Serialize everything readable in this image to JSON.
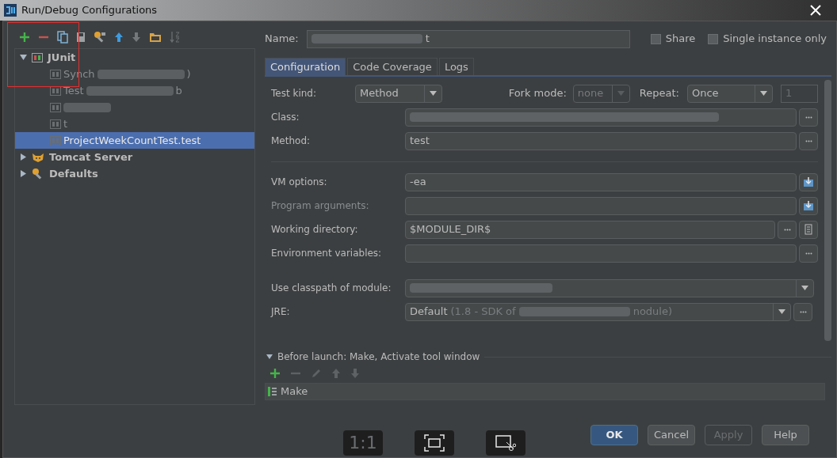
{
  "window": {
    "title": "Run/Debug Configurations"
  },
  "toolbar": [
    {
      "kind": "add"
    },
    {
      "kind": "remove"
    },
    {
      "kind": "copy"
    },
    {
      "kind": "save"
    },
    {
      "kind": "edit-defaults"
    },
    {
      "kind": "up"
    },
    {
      "kind": "down"
    },
    {
      "kind": "folder"
    },
    {
      "kind": "sort"
    }
  ],
  "tree": [
    {
      "label": "JUnit",
      "kind": "junit",
      "expanded": true,
      "children": [
        {
          "label": "Synch",
          "tail": ")",
          "selected": false
        },
        {
          "label": "Test",
          "tail": "b",
          "selected": false
        },
        {
          "kind": "redacted",
          "selected": false
        },
        {
          "label": "t",
          "selected": false
        },
        {
          "label": "ProjectWeekCountTest.test",
          "selected": true
        }
      ]
    },
    {
      "label": "Tomcat Server",
      "kind": "tomcat",
      "expanded": false
    },
    {
      "label": "Defaults",
      "kind": "defaults",
      "expanded": false
    }
  ],
  "name": {
    "label": "Name:",
    "value": "t"
  },
  "options": [
    {
      "label": "Share",
      "checked": false
    },
    {
      "label": "Single instance only",
      "checked": false
    }
  ],
  "tabs": [
    {
      "label": "Configuration",
      "selected": true
    },
    {
      "label": "Code Coverage",
      "selected": false
    },
    {
      "label": "Logs",
      "selected": false
    }
  ],
  "test_kind": {
    "label": "Test kind:",
    "value": "Method"
  },
  "fork_mode": {
    "label": "Fork mode:",
    "value": "none",
    "disabled": true
  },
  "repeat": {
    "label": "Repeat:",
    "value": "Once",
    "count": "1"
  },
  "fields": [
    {
      "label": "Class:",
      "kind": "redacted",
      "buttons": [
        {
          "kind": "browse"
        }
      ]
    },
    {
      "label": "Method:",
      "value": "test",
      "buttons": [
        {
          "kind": "browse"
        }
      ]
    },
    {
      "kind": "separator"
    },
    {
      "label": "VM options:",
      "value": "-ea",
      "buttons": [
        {
          "kind": "expand"
        }
      ]
    },
    {
      "label": "Program arguments:",
      "disabled": true,
      "buttons": [
        {
          "kind": "expand"
        }
      ]
    },
    {
      "label": "Working directory:",
      "value": "$MODULE_DIR$",
      "buttons": [
        {
          "kind": "browse"
        },
        {
          "kind": "macro"
        }
      ]
    },
    {
      "label": "Environment variables:",
      "buttons": [
        {
          "kind": "browse"
        }
      ]
    },
    {
      "kind": "spacer"
    },
    {
      "label": "Use classpath of module:",
      "kind": "module"
    },
    {
      "label": "JRE:",
      "kind": "jre",
      "value": "Default",
      "detail": "(1.8 - SDK of",
      "tail": "nodule)"
    }
  ],
  "before_launch": {
    "title": "Before launch: Make, Activate tool window",
    "tools": [
      {
        "kind": "add",
        "disabled": false
      },
      {
        "kind": "remove",
        "disabled": true
      },
      {
        "kind": "edit",
        "disabled": true
      },
      {
        "kind": "up",
        "disabled": true
      },
      {
        "kind": "down",
        "disabled": true
      }
    ],
    "tasks": [
      "Make"
    ]
  },
  "buttons": [
    {
      "label": "OK",
      "kind": "default",
      "disabled": false
    },
    {
      "label": "Cancel",
      "kind": "normal",
      "disabled": false
    },
    {
      "label": "Apply",
      "kind": "normal",
      "disabled": true
    },
    {
      "label": "Help",
      "kind": "normal",
      "disabled": false
    }
  ],
  "viewer_bar": [
    {
      "kind": "text",
      "label": "1:1"
    },
    {
      "kind": "fit"
    },
    {
      "kind": "crop"
    }
  ]
}
